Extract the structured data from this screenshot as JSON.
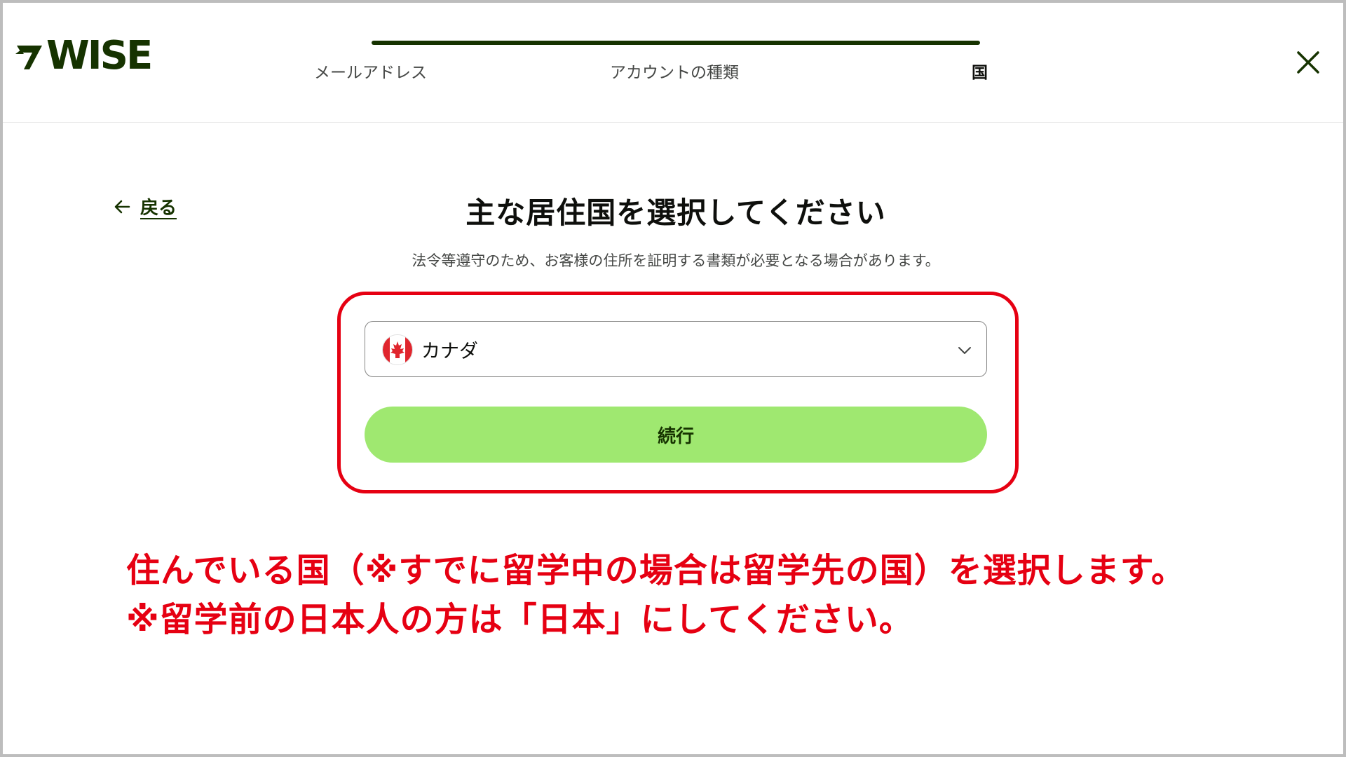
{
  "header": {
    "logo_text": "WISE",
    "steps": [
      {
        "label": "メールアドレス"
      },
      {
        "label": "アカウントの種類"
      },
      {
        "label": "国"
      }
    ],
    "progress": 1.0
  },
  "back": {
    "label": "戻る"
  },
  "main": {
    "title": "主な居住国を選択してください",
    "subtitle": "法令等遵守のため、お客様の住所を証明する書類が必要となる場合があります。",
    "country_select": {
      "value": "カナダ"
    },
    "continue_label": "続行"
  },
  "annotation": {
    "line1": "住んでいる国（※すでに留学中の場合は留学先の国）を選択します。",
    "line2": "※留学前の日本人の方は「日本」にしてください。"
  },
  "icons": {
    "logo": "wise-flag-logo",
    "close": "close-icon",
    "back": "arrow-left-icon",
    "flag": "canada-flag-icon",
    "chevron": "chevron-down-icon"
  },
  "colors": {
    "brand_dark": "#163300",
    "brand_green": "#9fe870",
    "annotation_red": "#e60012"
  }
}
